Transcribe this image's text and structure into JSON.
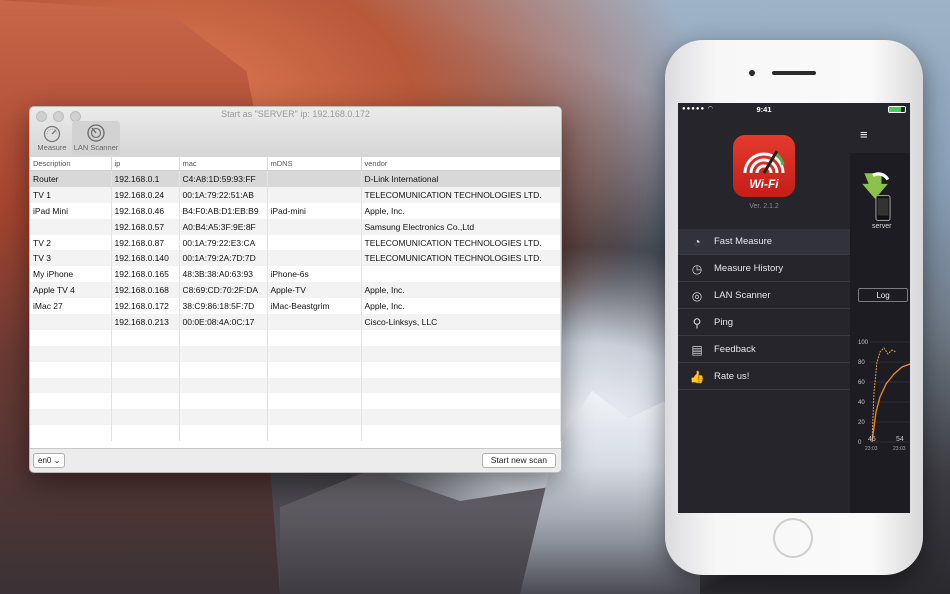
{
  "window": {
    "title": "Start as \"SERVER\" ip: 192.168.0.172",
    "toolbar": [
      {
        "label": "Measure",
        "icon": "gauge-icon"
      },
      {
        "label": "LAN Scanner",
        "icon": "scan-icon"
      }
    ],
    "columns": [
      "Description",
      "ip",
      "mac",
      "mDNS",
      "vendor"
    ],
    "rows": [
      [
        "Router",
        "192.168.0.1",
        "C4:A8:1D:59:93:FF",
        "",
        "D-Link International"
      ],
      [
        "TV 1",
        "192.168.0.24",
        "00:1A:79:22:51:AB",
        "",
        "TELECOMUNICATION TECHNOLOGIES LTD."
      ],
      [
        "iPad Mini",
        "192.168.0.46",
        "B4:F0:AB:D1:EB:B9",
        "iPad-mini",
        "Apple, Inc."
      ],
      [
        "",
        "192.168.0.57",
        "A0:B4:A5:3F:9E:8F",
        "",
        "Samsung Electronics Co.,Ltd"
      ],
      [
        "TV 2",
        "192.168.0.87",
        "00:1A:79:22:E3:CA",
        "",
        "TELECOMUNICATION TECHNOLOGIES LTD."
      ],
      [
        "TV 3",
        "192.168.0.140",
        "00:1A:79:2A:7D:7D",
        "",
        "TELECOMUNICATION TECHNOLOGIES LTD."
      ],
      [
        "My iPhone",
        "192.168.0.165",
        "48:3B:38:A0:63:93",
        "iPhone-6s",
        ""
      ],
      [
        "Apple TV 4",
        "192.168.0.168",
        "C8:69:CD:70:2F:DA",
        "Apple-TV",
        "Apple, Inc."
      ],
      [
        "iMac 27",
        "192.168.0.172",
        "38:C9:86:18:5F:7D",
        "iMac-Beastgrim",
        "Apple, Inc."
      ],
      [
        "",
        "192.168.0.213",
        "00:0E:08:4A:0C:17",
        "",
        "Cisco-Linksys, LLC"
      ]
    ],
    "interface_select": "en0",
    "scan_button": "Start new scan"
  },
  "phone": {
    "time": "9:41",
    "logo_text": "Wi-Fi",
    "version": "Ver. 2.1.2",
    "menu": [
      {
        "label": "Fast Measure",
        "icon": "gauge-icon"
      },
      {
        "label": "Measure History",
        "icon": "history-icon"
      },
      {
        "label": "LAN Scanner",
        "icon": "scan-icon"
      },
      {
        "label": "Ping",
        "icon": "ping-icon"
      },
      {
        "label": "Feedback",
        "icon": "feedback-icon"
      },
      {
        "label": "Rate us!",
        "icon": "thumbs-up-icon"
      }
    ],
    "side": {
      "menu_glyph": "≡",
      "device_label": "server",
      "log_button": "Log",
      "chart_yticks": [
        "100",
        "80",
        "60",
        "40",
        "20",
        "0"
      ],
      "chart_xticks": [
        "45",
        "54"
      ],
      "chart_xsub": [
        "23:03",
        "23:03"
      ]
    }
  }
}
